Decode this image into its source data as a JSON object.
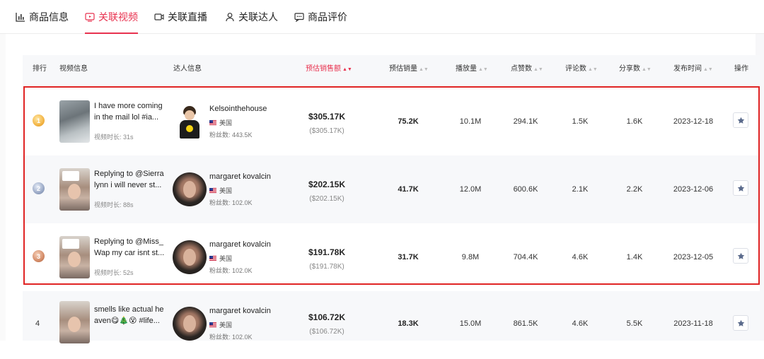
{
  "tabs": [
    {
      "label": "商品信息",
      "icon": "bar-chart-icon",
      "active": false
    },
    {
      "label": "关联视频",
      "icon": "video-icon",
      "active": true
    },
    {
      "label": "关联直播",
      "icon": "live-camera-icon",
      "active": false
    },
    {
      "label": "关联达人",
      "icon": "person-icon",
      "active": false
    },
    {
      "label": "商品评价",
      "icon": "comment-icon",
      "active": false
    }
  ],
  "table": {
    "columns": {
      "rank": "排行",
      "video": "视频信息",
      "creator": "达人信息",
      "est_sales_amount": "预估销售额",
      "est_sales_volume": "预估销量",
      "views": "播放量",
      "likes": "点赞数",
      "comments": "评论数",
      "shares": "分享数",
      "publish_time": "发布时间",
      "actions": "操作"
    },
    "sorted_column": "est_sales_amount",
    "duration_label": "视频时长:",
    "fans_label": "粉丝数:",
    "rows": [
      {
        "rank": "1",
        "medal": "gold",
        "video_title": "I have more coming in the mail lol #ia...",
        "duration": "31s",
        "creator_name": "Kelsointhehouse",
        "region": "美国",
        "fans": "443.5K",
        "amount": "$305.17K",
        "amount_sub": "($305.17K)",
        "volume": "75.2K",
        "views": "10.1M",
        "likes": "294.1K",
        "comments": "1.5K",
        "shares": "1.6K",
        "date": "2023-12-18"
      },
      {
        "rank": "2",
        "medal": "silver",
        "video_title": "Replying to @Sierra lynn i will never st...",
        "duration": "88s",
        "creator_name": "margaret kovalcin",
        "region": "美国",
        "fans": "102.0K",
        "amount": "$202.15K",
        "amount_sub": "($202.15K)",
        "volume": "41.7K",
        "views": "12.0M",
        "likes": "600.6K",
        "comments": "2.1K",
        "shares": "2.2K",
        "date": "2023-12-06"
      },
      {
        "rank": "3",
        "medal": "bronze",
        "video_title": "Replying to @Miss_ Wap my car isnt st...",
        "duration": "52s",
        "creator_name": "margaret kovalcin",
        "region": "美国",
        "fans": "102.0K",
        "amount": "$191.78K",
        "amount_sub": "($191.78K)",
        "volume": "31.7K",
        "views": "9.8M",
        "likes": "704.4K",
        "comments": "4.6K",
        "shares": "1.4K",
        "date": "2023-12-05"
      },
      {
        "rank": "4",
        "medal": "",
        "video_title": "smells like actual he aven😋🎄😵 #life...",
        "duration": "",
        "creator_name": "margaret kovalcin",
        "region": "美国",
        "fans": "102.0K",
        "amount": "$106.72K",
        "amount_sub": "($106.72K)",
        "volume": "18.3K",
        "views": "15.0M",
        "likes": "861.5K",
        "comments": "4.6K",
        "shares": "5.5K",
        "date": "2023-11-18"
      }
    ]
  },
  "colors": {
    "accent": "#e8324f",
    "highlight_border": "#e02424"
  }
}
